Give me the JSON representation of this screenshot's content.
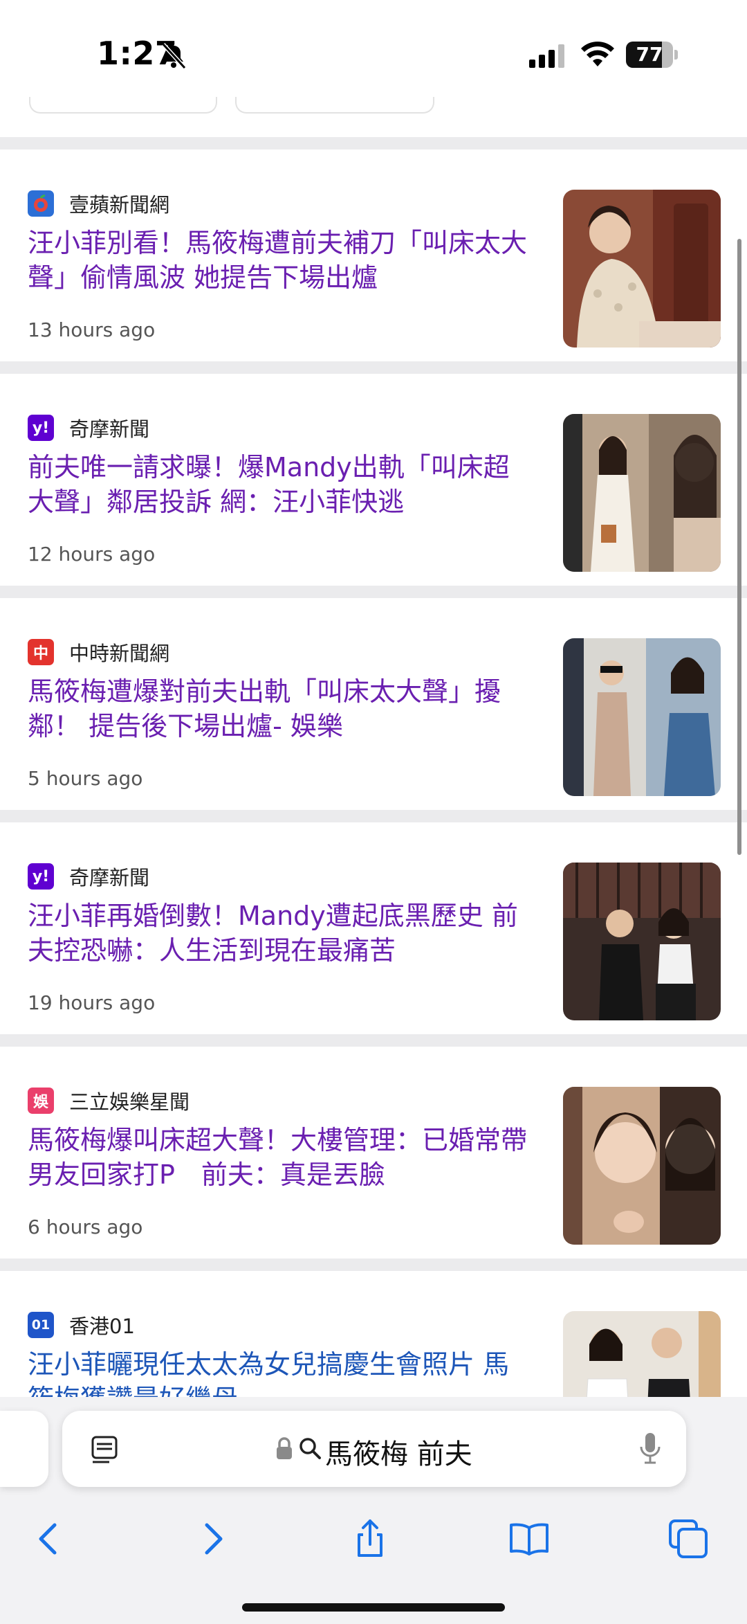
{
  "status_bar": {
    "time": "1:27",
    "battery": "77",
    "battery_level": 0.77,
    "icons": [
      "bell-slash-icon",
      "cellular-signal-icon",
      "wifi-icon",
      "battery-icon"
    ]
  },
  "feed": [
    {
      "source": "壹蘋新聞網",
      "logo_icon": "apple-daily-logo",
      "logo_color": "#2c6fd6",
      "headline": "汪小菲別看！馬筱梅遭前夫補刀「叫床太大聲」偷情風波 她提告下場出爐",
      "time": "13 hours ago",
      "headline_color": "#6a1fb0"
    },
    {
      "source": "奇摩新聞",
      "logo_icon": "yahoo-logo",
      "logo_text": "y!",
      "logo_color": "#5f01d1",
      "headline": "前夫唯一請求曝！爆Mandy出軌「叫床超大聲」鄰居投訴 網：汪小菲快逃",
      "time": "12 hours ago",
      "headline_color": "#6a1fb0"
    },
    {
      "source": "中時新聞網",
      "logo_icon": "china-times-logo",
      "logo_text": "中",
      "logo_color": "#e3332d",
      "headline": "馬筱梅遭爆對前夫出軌「叫床太大聲」擾鄰！ 提告後下場出爐- 娛樂",
      "time": "5 hours ago",
      "headline_color": "#6a1fb0"
    },
    {
      "source": "奇摩新聞",
      "logo_icon": "yahoo-logo",
      "logo_text": "y!",
      "logo_color": "#5f01d1",
      "headline": "汪小菲再婚倒數！Mandy遭起底黑歷史 前夫控恐嚇：人生活到現在最痛苦",
      "time": "19 hours ago",
      "headline_color": "#6a1fb0"
    },
    {
      "source": "三立娛樂星聞",
      "logo_icon": "setn-star-logo",
      "logo_text": "娛",
      "logo_color": "#ea3f6b",
      "headline": "馬筱梅爆叫床超大聲！大樓管理：已婚常帶男友回家打P　前夫：真是丟臉",
      "time": "6 hours ago",
      "headline_color": "#6a1fb0"
    },
    {
      "source": "香港01",
      "logo_icon": "hk01-logo",
      "logo_text": "01",
      "logo_color": "#1f55c9",
      "headline": "汪小菲曬現任太太為女兒搞慶生會照片 馬筱梅獲讚最好繼母",
      "time": "",
      "headline_color": "#1d56b8"
    }
  ],
  "address_bar": {
    "query": "馬筱梅 前夫",
    "icons": [
      "reader-icon",
      "lock-icon",
      "search-icon",
      "microphone-icon"
    ]
  },
  "toolbar": {
    "buttons": [
      "back-button",
      "forward-button",
      "share-button",
      "bookmarks-button",
      "tabs-button"
    ]
  }
}
